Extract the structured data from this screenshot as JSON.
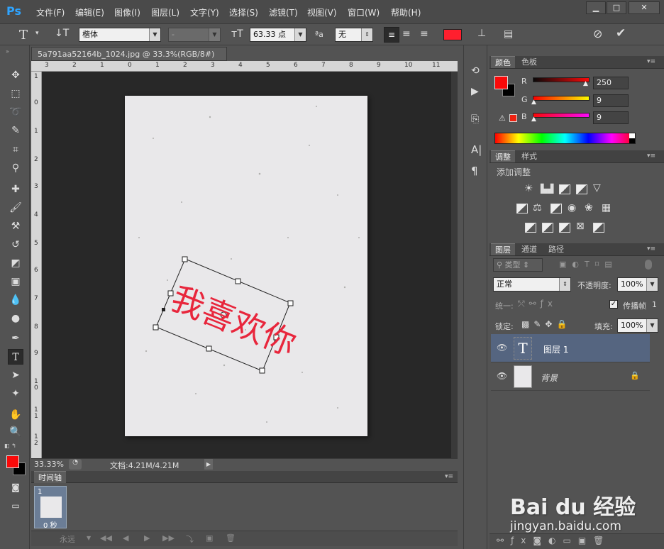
{
  "app": {
    "logo": "Ps",
    "menus": [
      "文件(F)",
      "编辑(E)",
      "图像(I)",
      "图层(L)",
      "文字(Y)",
      "选择(S)",
      "滤镜(T)",
      "视图(V)",
      "窗口(W)",
      "帮助(H)"
    ]
  },
  "options": {
    "font_family": "楷体",
    "font_style": "-",
    "font_size": "63.33 点",
    "aa_mode": "无",
    "text_color": "#ff1f2e"
  },
  "document": {
    "tab_title": "5a791aa52164b_1024.jpg @ 33.3%(RGB/8#)",
    "close": "×",
    "stamp_text": "我喜欢你",
    "stamp_color": "#e8263c"
  },
  "rulers": {
    "h": [
      "3",
      "2",
      "1",
      "0",
      "1",
      "2",
      "3",
      "4",
      "5",
      "6",
      "7",
      "8",
      "9",
      "10",
      "11"
    ],
    "v": [
      "1",
      "0",
      "1",
      "2",
      "3",
      "4",
      "5",
      "6",
      "7",
      "8",
      "9",
      "1 0",
      "1 1",
      "1 2"
    ]
  },
  "status": {
    "zoom": "33.33%",
    "doc_info": "文档:4.21M/4.21M"
  },
  "timeline": {
    "title": "时间轴",
    "frame_number": "1",
    "frame_delay": "0 秒",
    "loop": "永远"
  },
  "color_panel": {
    "tabs": [
      "颜色",
      "色板"
    ],
    "channels": [
      {
        "label": "R",
        "value": "250"
      },
      {
        "label": "G",
        "value": "9"
      },
      {
        "label": "B",
        "value": "9"
      }
    ],
    "fg": "#fa0909",
    "bg": "#000000"
  },
  "adjust_panel": {
    "tabs": [
      "调整",
      "样式"
    ],
    "title": "添加调整"
  },
  "layers_panel": {
    "tabs": [
      "图层",
      "通道",
      "路径"
    ],
    "filter": "类型",
    "blend_mode": "正常",
    "opacity_label": "不透明度:",
    "opacity": "100%",
    "unify_label": "统一:",
    "propagate_label": "传播帧",
    "propagate_num": "1",
    "lock_label": "锁定:",
    "fill_label": "填充:",
    "fill": "100%",
    "layers": [
      {
        "name": "图层 1",
        "type": "text",
        "selected": true
      },
      {
        "name": "背景",
        "type": "image",
        "locked": true
      }
    ]
  },
  "watermark": {
    "brand": "Bai du 经验",
    "url": "jingyan.baidu.com"
  }
}
